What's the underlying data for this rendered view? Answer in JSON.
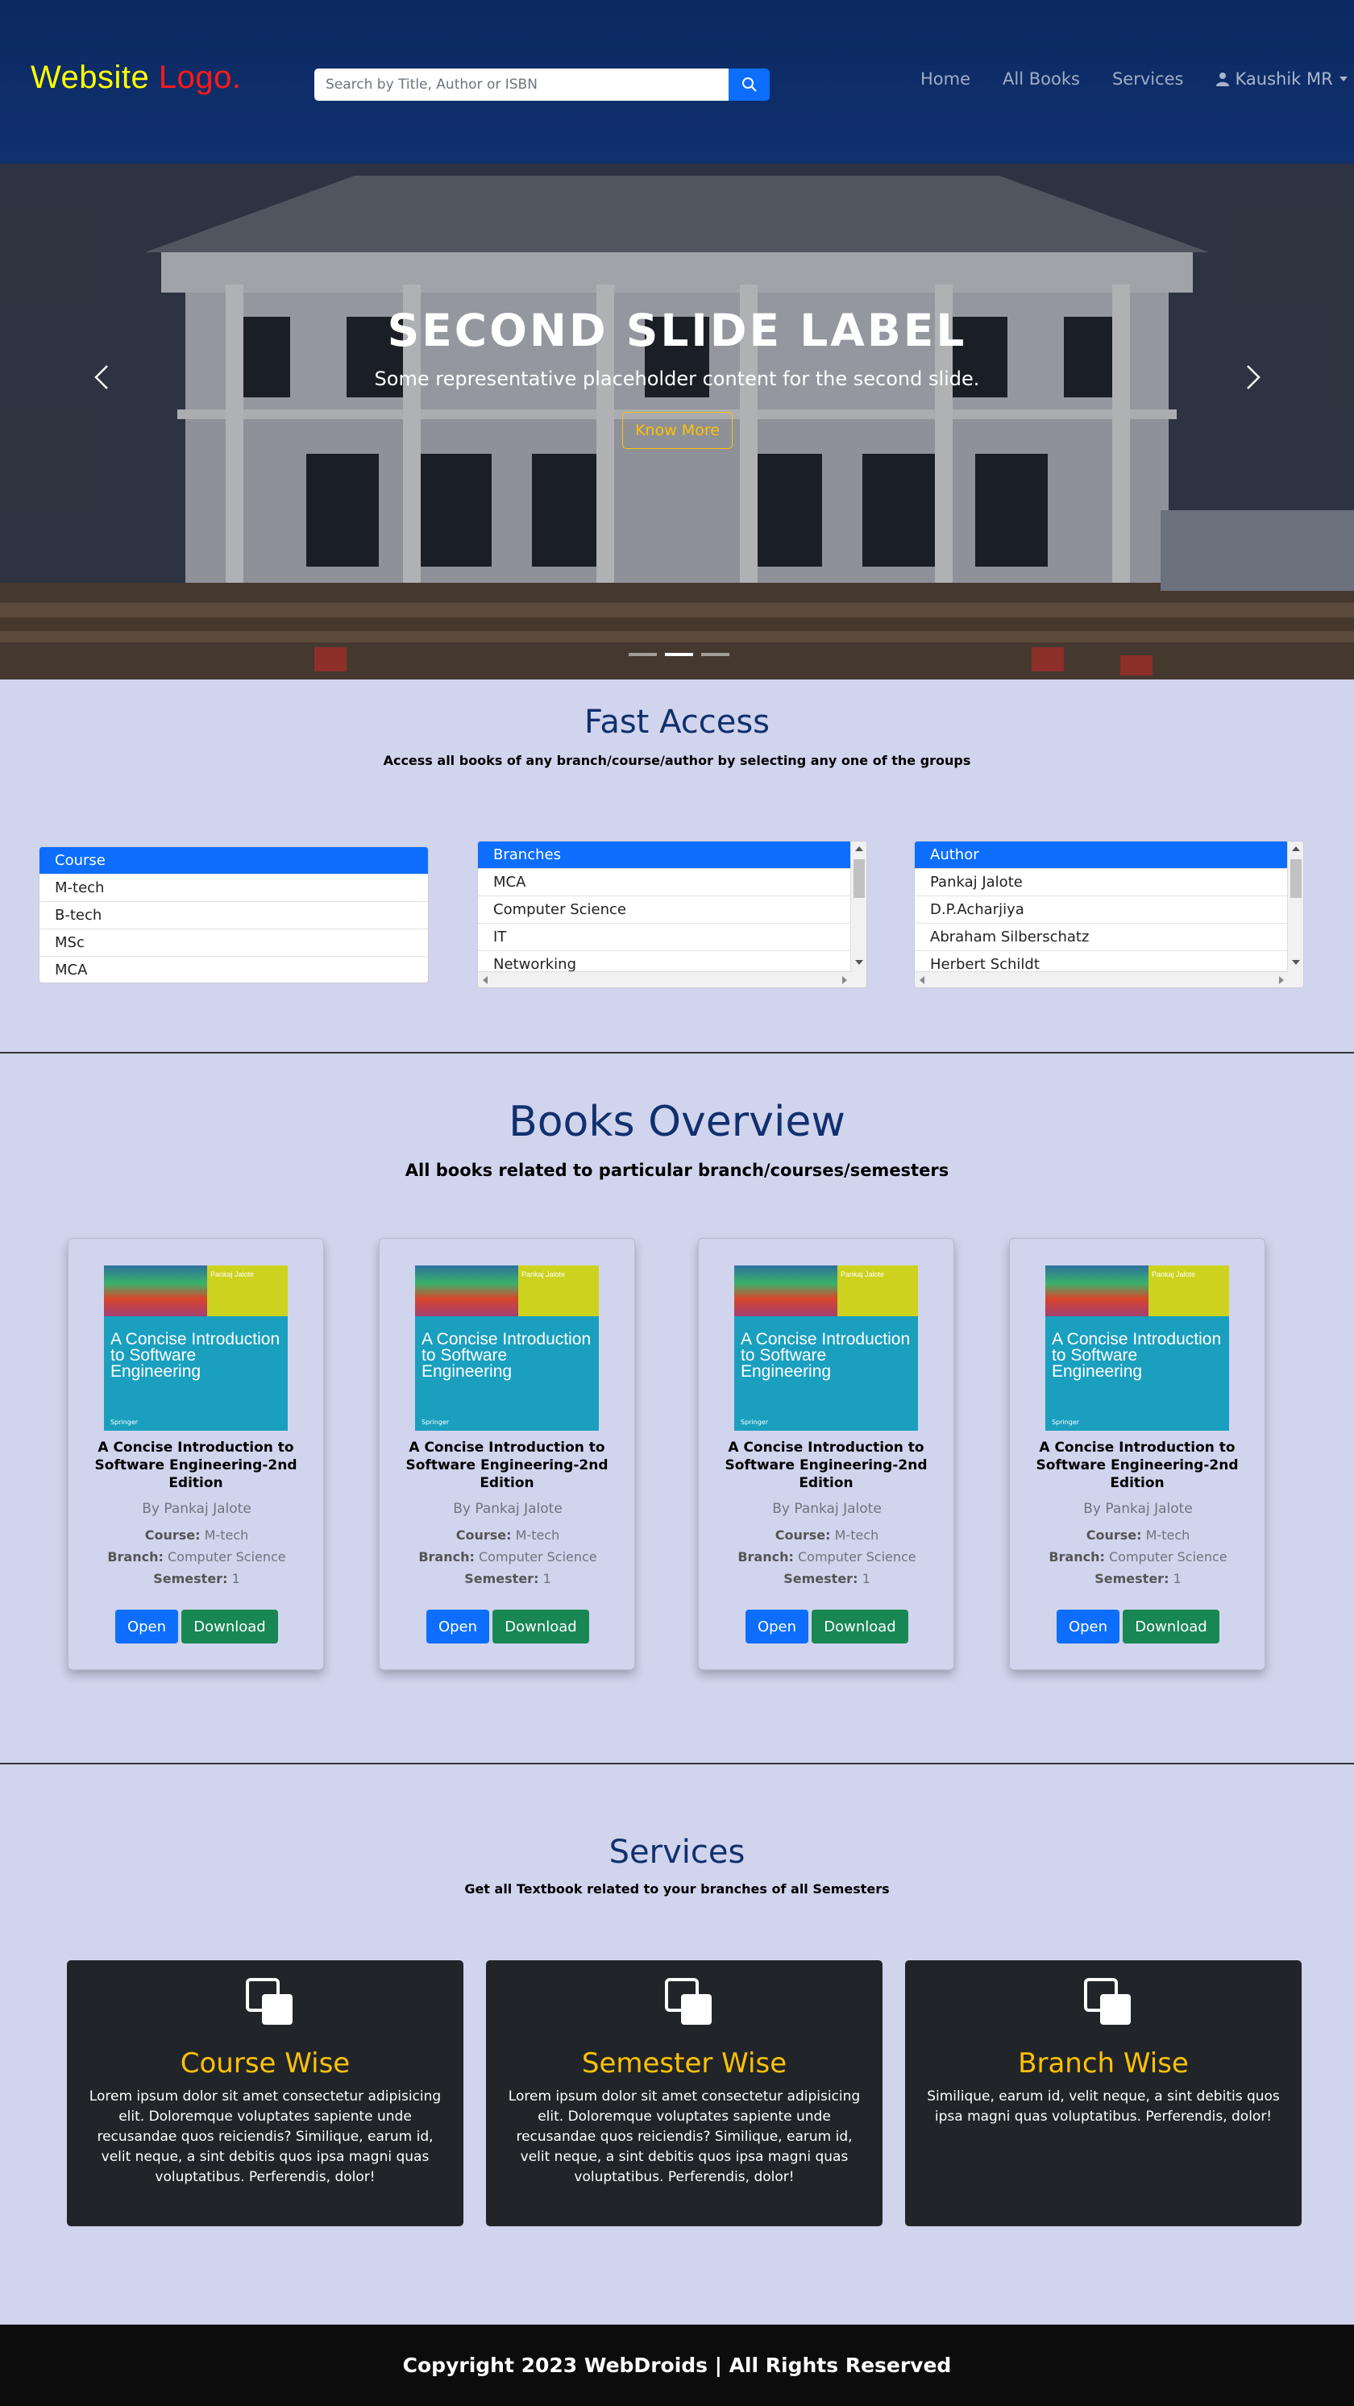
{
  "header": {
    "logo_part1": "Website",
    "logo_part2": "Logo.",
    "search_placeholder": "Search by Title, Author or ISBN",
    "nav": [
      "Home",
      "All Books",
      "Services"
    ],
    "user": "Kaushik MR"
  },
  "hero": {
    "title": "Second slide label",
    "subtitle": "Some representative placeholder content for the second slide.",
    "button": "Know More",
    "active_slide": 2,
    "slide_count": 3
  },
  "fast_access": {
    "title": "Fast Access",
    "subtitle": "Access all books of any branch/course/author by selecting any one of the groups",
    "lists": [
      {
        "header": "Course",
        "items": [
          "M-tech",
          "B-tech",
          "MSc",
          "MCA"
        ]
      },
      {
        "header": "Branches",
        "items": [
          "MCA",
          "Computer Science",
          "IT",
          "Networking"
        ]
      },
      {
        "header": "Author",
        "items": [
          "Pankaj Jalote",
          "D.P.Acharjiya",
          "Abraham Silberschatz",
          "Herbert Schildt"
        ]
      }
    ]
  },
  "books": {
    "title": "Books Overview",
    "subtitle": "All books related to particular branch/courses/semesters",
    "cover": {
      "author": "Pankaj Jalote",
      "title": "A Concise Introduction to Software Engineering",
      "publisher": "Springer"
    },
    "labels": {
      "course": "Course:",
      "branch": "Branch:",
      "semester": "Semester:",
      "open": "Open",
      "download": "Download"
    },
    "items": [
      {
        "title": "A Concise Introduction to Software Engineering-2nd Edition",
        "author": "By Pankaj Jalote",
        "course": "M-tech",
        "branch": "Computer Science",
        "semester": "1"
      },
      {
        "title": "A Concise Introduction to Software Engineering-2nd Edition",
        "author": "By Pankaj Jalote",
        "course": "M-tech",
        "branch": "Computer Science",
        "semester": "1"
      },
      {
        "title": "A Concise Introduction to Software Engineering-2nd Edition",
        "author": "By Pankaj Jalote",
        "course": "M-tech",
        "branch": "Computer Science",
        "semester": "1"
      },
      {
        "title": "A Concise Introduction to Software Engineering-2nd Edition",
        "author": "By Pankaj Jalote",
        "course": "M-tech",
        "branch": "Computer Science",
        "semester": "1"
      }
    ]
  },
  "services": {
    "title": "Services",
    "subtitle": "Get all Textbook related to your branches of all Semesters",
    "items": [
      {
        "title": "Course Wise",
        "text": "Lorem ipsum dolor sit amet consectetur adipisicing elit. Doloremque voluptates sapiente unde recusandae quos reiciendis? Similique, earum id, velit neque, a sint debitis quos ipsa magni quas voluptatibus. Perferendis, dolor!"
      },
      {
        "title": "Semester Wise",
        "text": "Lorem ipsum dolor sit amet consectetur adipisicing elit. Doloremque voluptates sapiente unde recusandae quos reiciendis? Similique, earum id, velit neque, a sint debitis quos ipsa magni quas voluptatibus. Perferendis, dolor!"
      },
      {
        "title": "Branch Wise",
        "text": "Similique, earum id, velit neque, a sint debitis quos ipsa magni quas voluptatibus. Perferendis, dolor!"
      }
    ]
  },
  "footer": {
    "text": "Copyright 2023 WebDroids | All Rights Reserved"
  },
  "colors": {
    "navbar": "#0b2a63",
    "primary": "#0d6efd",
    "success": "#198754",
    "accent": "#ffc107",
    "page_bg": "#d1d4ed",
    "dark_card": "#212529"
  },
  "icons": [
    "search-icon",
    "user-icon",
    "chevron-left-icon",
    "chevron-right-icon",
    "copy-icon"
  ]
}
